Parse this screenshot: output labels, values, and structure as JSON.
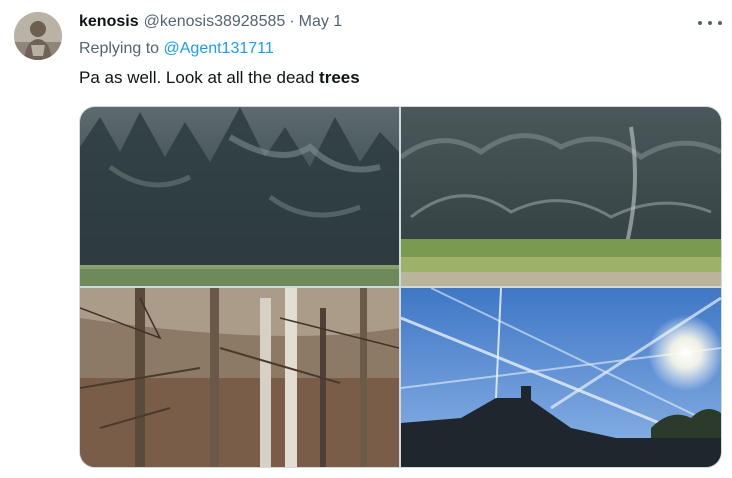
{
  "tweet": {
    "author_name": "kenosis",
    "author_handle": "@kenosis38928585",
    "separator": "·",
    "date": "May 1",
    "replying_prefix": "Replying to ",
    "replying_to": "@Agent131711",
    "text_plain": "Pa as well. Look at all the dead ",
    "text_bold": "trees"
  },
  "media": {
    "photos": [
      {
        "label": "dense dark conifer forest edge with grass"
      },
      {
        "label": "sagging conifers above a green field"
      },
      {
        "label": "bare dead tree trunks on forest floor"
      },
      {
        "label": "blue sky with crossing contrails and sun over rooftop"
      }
    ]
  },
  "icons": {
    "more": "more-horizontal-icon",
    "avatar": "profile-photo"
  },
  "colors": {
    "text": "#0f1419",
    "secondary": "#536471",
    "link": "#1d9bf0",
    "border": "#cfd9de"
  }
}
